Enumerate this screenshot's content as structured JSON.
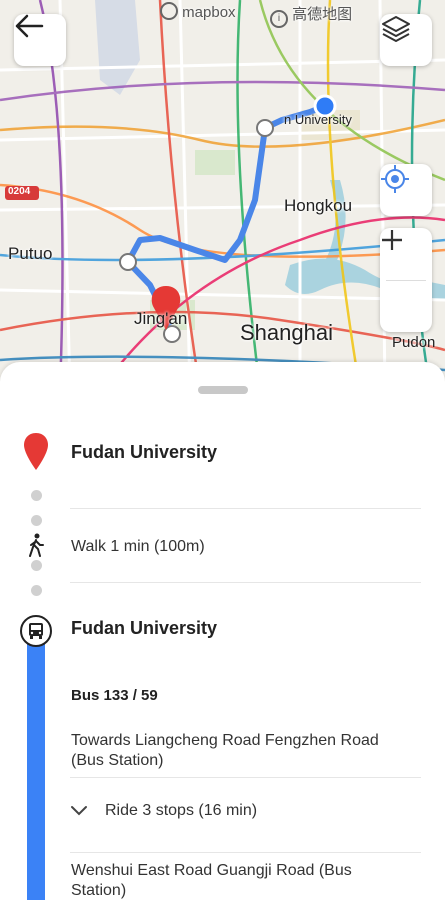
{
  "map": {
    "attribution_mapbox": "mapbox",
    "attribution_amap": "高德地图",
    "road_shield": "0204",
    "labels": {
      "putuo": "Putuo",
      "hongkou": "Hongkou",
      "jingan": "Jing'an",
      "shanghai": "Shanghai",
      "pudong": "Pudon",
      "university": "n University"
    }
  },
  "steps": {
    "origin": {
      "title": "Fudan University",
      "icon": "location-pin-icon"
    },
    "walk": {
      "text": "Walk 1 min (100m)",
      "icon": "walking-person-icon"
    },
    "bus_stop": {
      "title": "Fudan University",
      "icon": "bus-icon"
    },
    "bus_line": "Bus 133 / 59",
    "towards_line1": "Towards Liangcheng Road Fengzhen Road",
    "towards_line2": "(Bus Station)",
    "ride": "Ride 3 stops (16 min)",
    "dest_line1": "Wenshui East Road Guangji Road (Bus",
    "dest_line2": "Station)"
  },
  "colors": {
    "route": "#4a86e8",
    "pin": "#e53935",
    "transit_bar": "#3b82f6"
  }
}
